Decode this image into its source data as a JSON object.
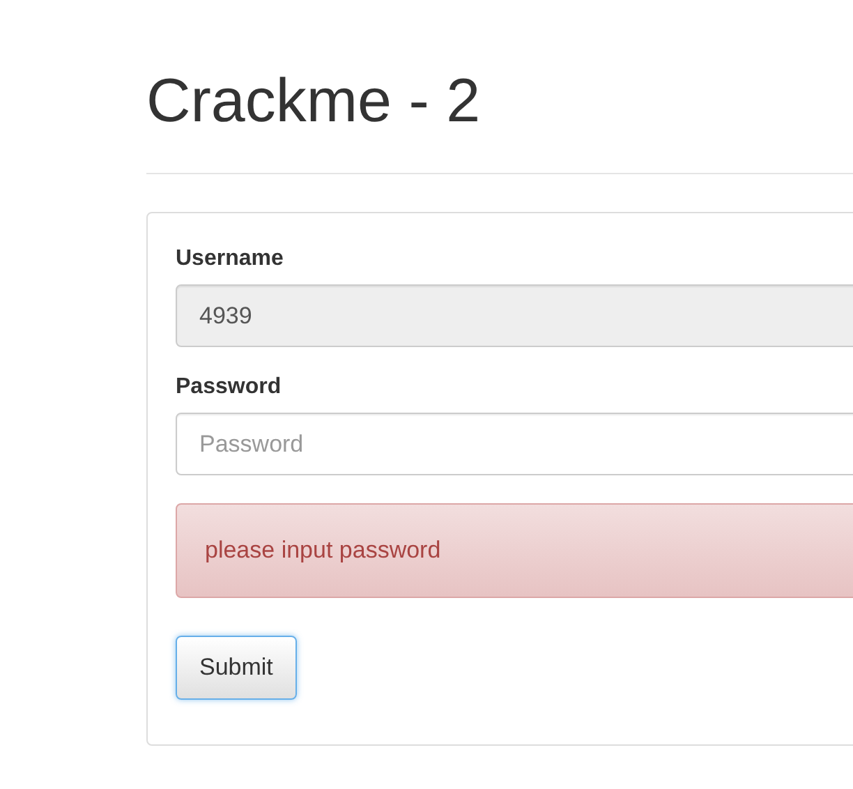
{
  "heading": "Crackme - 2",
  "fields": [
    {
      "label": "Username",
      "value": "4939",
      "disabled": true
    },
    {
      "label": "Password",
      "placeholder": "Password",
      "disabled": false
    }
  ],
  "alert": "please input password",
  "submit": {
    "label": "Submit",
    "focused": true
  }
}
